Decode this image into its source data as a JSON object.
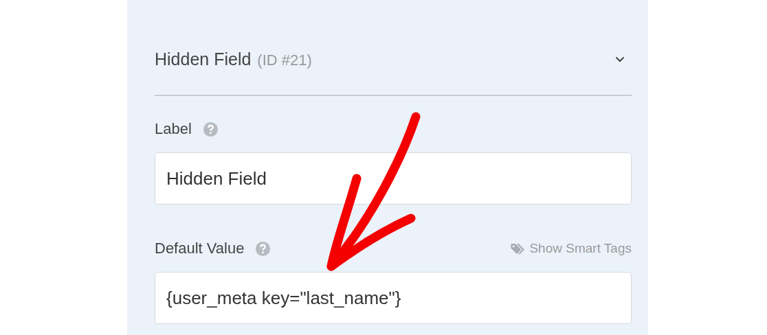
{
  "panel": {
    "title": "Hidden Field",
    "id_label": "(ID #21)",
    "expanded": true
  },
  "fields": [
    {
      "label": "Label",
      "value": "Hidden Field"
    },
    {
      "label": "Default Value",
      "value": "{user_meta key=\"last_name\"}",
      "smart_tags": "Show Smart Tags"
    }
  ]
}
